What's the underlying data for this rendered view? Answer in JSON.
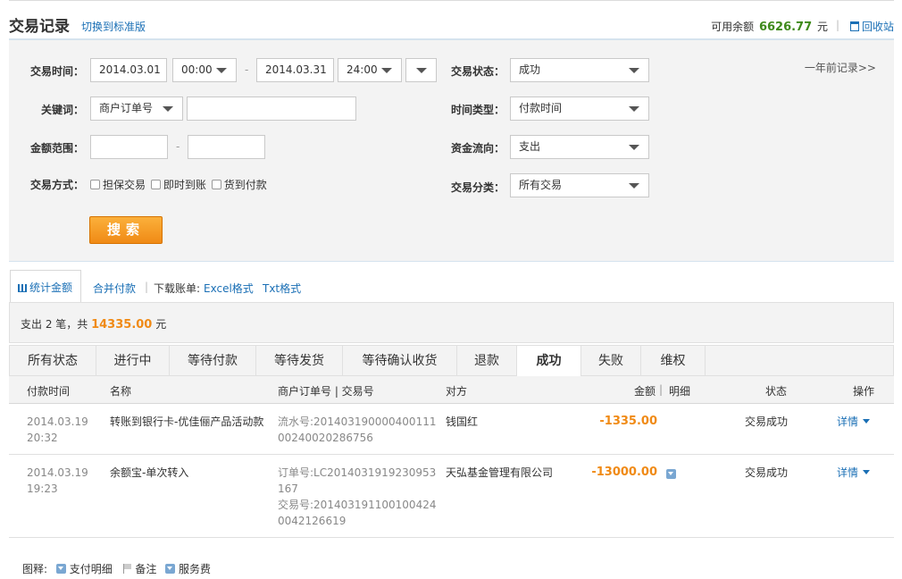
{
  "header": {
    "title": "交易记录",
    "switch_link": "切换到标准版",
    "balance_label": "可用余额",
    "balance_value": "6626.77",
    "balance_unit": "元",
    "recycle": "回收站"
  },
  "form": {
    "time_label": "交易时间：",
    "date_from": "2014.03.01",
    "time_from": "00:00",
    "date_to": "2014.03.31",
    "time_to": "24:00",
    "dash": "-",
    "status_label": "交易状态：",
    "status_value": "成功",
    "one_year": "一年前记录>>",
    "keyword_label": "关键词：",
    "keyword_type": "商户订单号",
    "keyword_value": "",
    "time_type_label": "时间类型：",
    "time_type_value": "付款时间",
    "amount_label": "金额范围：",
    "amount_min": "",
    "amount_max": "",
    "flow_label": "资金流向：",
    "flow_value": "支出",
    "method_label": "交易方式：",
    "methods": [
      "担保交易",
      "即时到账",
      "货到付款"
    ],
    "category_label": "交易分类：",
    "category_value": "所有交易",
    "search_btn": "搜索"
  },
  "stats": {
    "tab_stats": "统计金额",
    "merge_pay": "合并付款",
    "download_label": "下载账单:",
    "excel": "Excel格式",
    "txt": "Txt格式",
    "summary_prefix": "支出 2 笔，共",
    "summary_amount": "14335.00",
    "summary_unit": "元"
  },
  "tabs": [
    "所有状态",
    "进行中",
    "等待付款",
    "等待发货",
    "等待确认收货",
    "退款",
    "成功",
    "失败",
    "维权"
  ],
  "active_tab": "成功",
  "columns": {
    "time": "付款时间",
    "name": "名称",
    "order": "商户订单号 | 交易号",
    "party": "对方",
    "amount": "金额",
    "detail": "明细",
    "status": "状态",
    "action": "操作"
  },
  "rows": [
    {
      "date": "2014.03.19",
      "time": "20:32",
      "name": "转账到银行卡-优佳俪产品活动款",
      "order_line1": "流水号:20140319000040011100240020286756",
      "order_line2": "",
      "party": "钱国红",
      "amount": "-1335.00",
      "status": "交易成功",
      "action": "详情"
    },
    {
      "date": "2014.03.19",
      "time": "19:23",
      "name": "余额宝-单次转入",
      "order_line1": "订单号:LC2014031919230953167",
      "order_line2": "交易号:2014031911001004240042126619",
      "party": "天弘基金管理有限公司",
      "amount": "-13000.00",
      "status": "交易成功",
      "action": "详情"
    }
  ],
  "legend": {
    "label": "图释:",
    "items": [
      "支付明细",
      "备注",
      "服务费"
    ]
  }
}
